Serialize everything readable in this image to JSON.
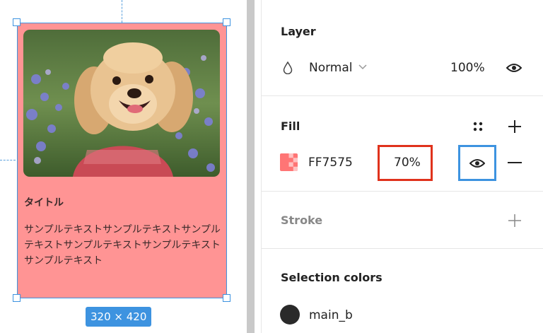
{
  "card": {
    "title": "タイトル",
    "body": "サンプルテキストサンプルテキストサンプルテキストサンプルテキストサンプルテキストサンプルテキスト",
    "size_label": "320 × 420"
  },
  "panel": {
    "layer": {
      "title": "Layer",
      "blend_mode": "Normal",
      "opacity": "100%"
    },
    "fill": {
      "title": "Fill",
      "color_hex": "FF7575",
      "opacity": "70%",
      "swatch_color": "#FF7575"
    },
    "stroke": {
      "title": "Stroke"
    },
    "selection_colors": {
      "title": "Selection colors",
      "color_name": "main_b",
      "color": "#2a2a2a"
    }
  },
  "colors": {
    "frame_fill": "#ff9494",
    "selection_blue": "#3d93e0",
    "highlight_red": "#e0321c"
  },
  "icons": {
    "blend": "drop-icon",
    "chevron": "chevron-down-icon",
    "visibility": "eye-icon",
    "styles": "four-dots-icon",
    "add": "plus-icon",
    "remove": "minus-icon"
  }
}
